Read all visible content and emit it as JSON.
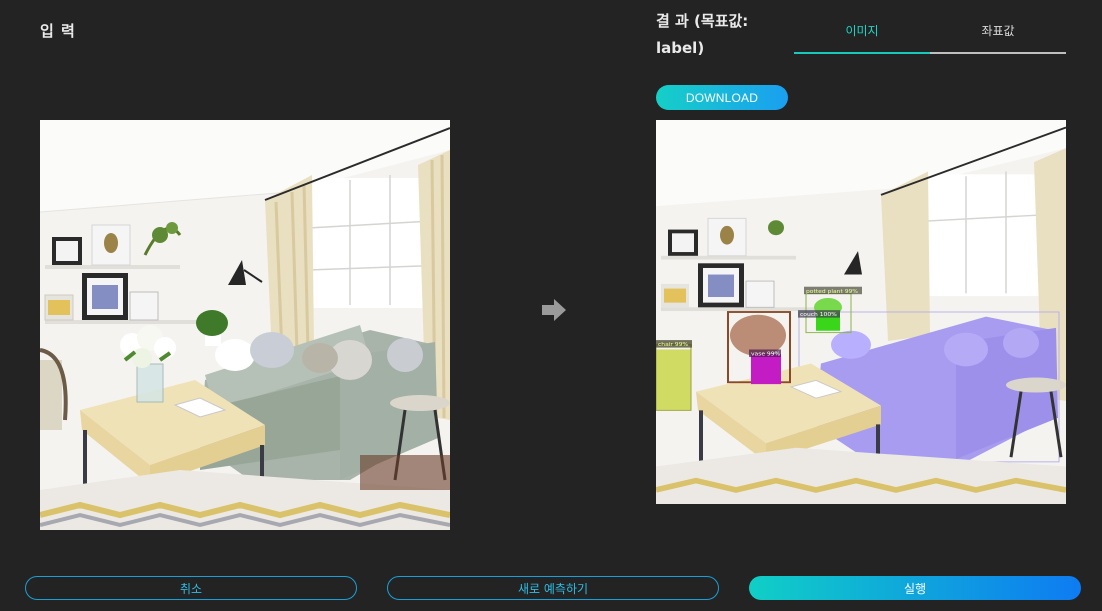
{
  "input": {
    "title": "입 력"
  },
  "result": {
    "title": "결 과 (목표값: label)"
  },
  "tabs": [
    {
      "label": "이미지",
      "active": true
    },
    {
      "label": "좌표값",
      "active": false
    }
  ],
  "download": {
    "label": "DOWNLOAD"
  },
  "detections": [
    {
      "label": "potted plant 99%"
    },
    {
      "label": "couch 100%"
    },
    {
      "label": "vase 99%"
    },
    {
      "label": "chair 99%"
    }
  ],
  "buttons": {
    "cancel": "취소",
    "new_predict": "새로 예측하기",
    "run": "실행"
  },
  "colors": {
    "accent": "#19c9bb",
    "button_outline": "#1aa0d8",
    "couch_mask": "#a89cf0",
    "plant_mask": "#39d61a",
    "vase_mask": "#c41cc4",
    "chair_mask": "#c9d64a"
  }
}
